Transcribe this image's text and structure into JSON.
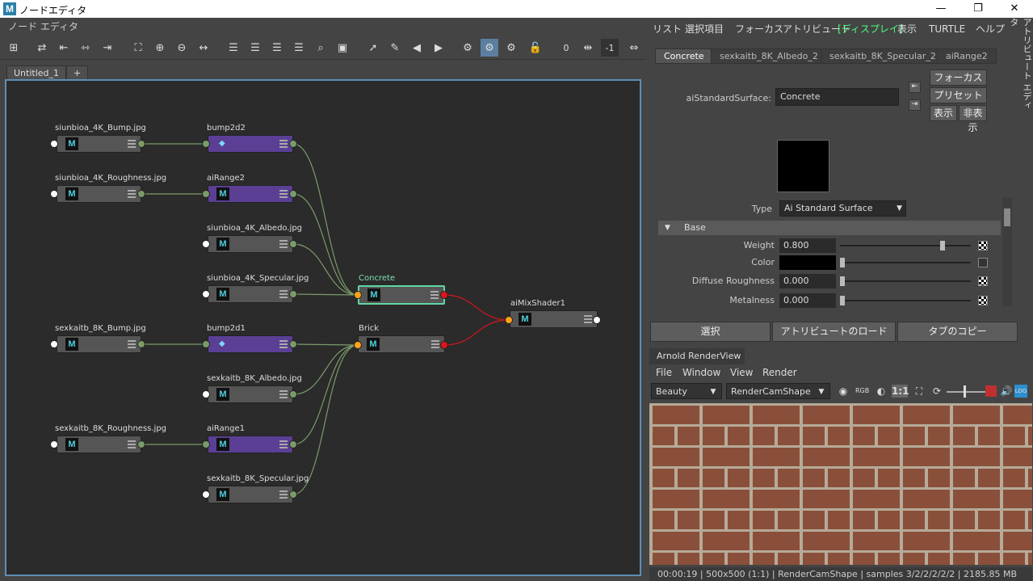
{
  "window": {
    "title": "ノードエディタ",
    "app_icon_letter": "M",
    "min": "—",
    "max": "❐",
    "close": "✕"
  },
  "left_menu": {
    "label": "ノード エディタ"
  },
  "toolbar": {
    "counter_value": "0",
    "negative_value": "-1"
  },
  "tabs": [
    {
      "label": "Untitled_1"
    },
    {
      "label": "+"
    }
  ],
  "nodes": {
    "n1": {
      "label": "siunbioa_4K_Bump.jpg",
      "m": "M"
    },
    "n2": {
      "label": "bump2d2"
    },
    "n3": {
      "label": "siunbioa_4K_Roughness.jpg",
      "m": "M"
    },
    "n4": {
      "label": "aiRange2",
      "m": "M"
    },
    "n5": {
      "label": "siunbioa_4K_Albedo.jpg",
      "m": "M"
    },
    "n6": {
      "label": "siunbioa_4K_Specular.jpg",
      "m": "M"
    },
    "n7": {
      "label": "Concrete",
      "m": "M"
    },
    "n8": {
      "label": "aiMixShader1",
      "m": "M"
    },
    "n9": {
      "label": "sexkaitb_8K_Bump.jpg",
      "m": "M"
    },
    "n10": {
      "label": "bump2d1"
    },
    "n11": {
      "label": "Brick",
      "m": "M"
    },
    "n12": {
      "label": "sexkaitb_8K_Albedo.jpg",
      "m": "M"
    },
    "n13": {
      "label": "sexkaitb_8K_Roughness.jpg",
      "m": "M"
    },
    "n14": {
      "label": "aiRange1",
      "m": "M"
    },
    "n15": {
      "label": "sexkaitb_8K_Specular.jpg",
      "m": "M"
    }
  },
  "right_menu": {
    "list": "リスト",
    "selected": "選択項目",
    "focus": "フォーカス",
    "attributes": "アトリビュート",
    "display": "[ディスプレイ]",
    "show": "表示",
    "turtle": "TURTLE",
    "help": "ヘルプ"
  },
  "side_tab": "アトリビュート エディタ",
  "ae_tabs": [
    {
      "label": "Concrete"
    },
    {
      "label": "sexkaitb_8K_Albedo_2"
    },
    {
      "label": "sexkaitb_8K_Specular_2"
    },
    {
      "label": "aiRange2"
    }
  ],
  "ae": {
    "node_type_label": "aiStandardSurface:",
    "node_name": "Concrete",
    "focus_btn": "フォーカス",
    "preset_btn": "プリセット",
    "show_btn": "表示",
    "hide_btn": "非表示",
    "type_label": "Type",
    "type_value": "Ai Standard Surface",
    "section": "Base",
    "rows": [
      {
        "label": "Weight",
        "value": "0.800",
        "level": 0.8
      },
      {
        "label": "Color",
        "value": "",
        "level": 0
      },
      {
        "label": "Diffuse Roughness",
        "value": "0.000",
        "level": 0
      },
      {
        "label": "Metalness",
        "value": "0.000",
        "level": 0
      }
    ],
    "buttons": {
      "select": "選択",
      "load": "アトリビュートのロード",
      "copy": "タブのコピー"
    }
  },
  "renderview": {
    "title": "Arnold RenderView",
    "menu": {
      "file": "File",
      "window": "Window",
      "view": "View",
      "render": "Render"
    },
    "aov": "Beauty",
    "camera": "RenderCamShape",
    "ratio": "1:1",
    "status": "00:00:19 | 500x500 (1:1) | RenderCamShape  | samples 3/2/2/2/2/2 | 2185.85 MB"
  }
}
